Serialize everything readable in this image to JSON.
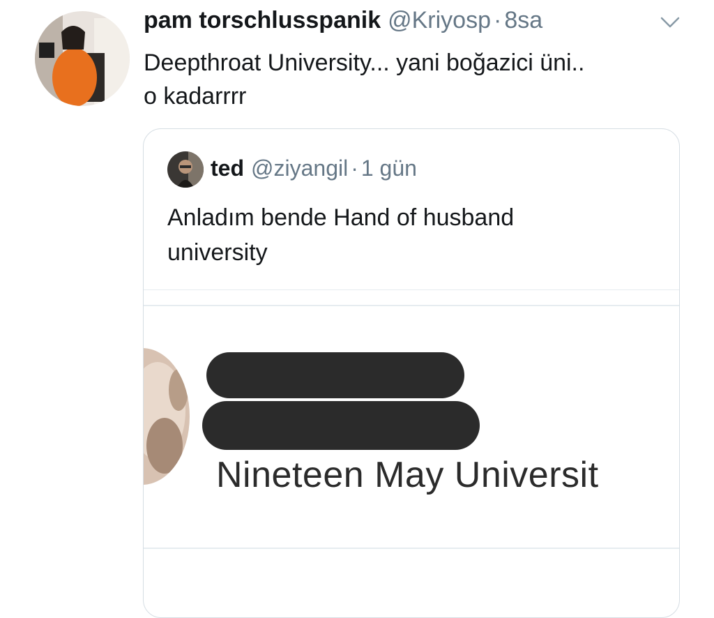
{
  "tweet": {
    "display_name": "pam torschlusspanik",
    "handle": "@Kriyosp",
    "separator": "·",
    "time": "8sa",
    "text_lines": [
      "Deepthroat University... yani boğazici üni..",
      "o kadarrrr"
    ]
  },
  "quoted_tweet": {
    "display_name": "ted",
    "handle": "@ziyangil",
    "separator": "·",
    "time": "1 gün",
    "text_lines": [
      "Anladım bende Hand of husband",
      "university"
    ],
    "media": {
      "caption_text": "Nineteen May Universit"
    }
  },
  "icons": {
    "caret": "chevron-down-icon"
  }
}
